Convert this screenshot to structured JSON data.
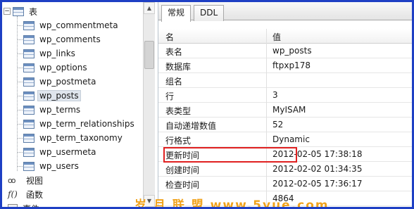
{
  "tree": {
    "root_label": "表",
    "tables": [
      "wp_commentmeta",
      "wp_comments",
      "wp_links",
      "wp_options",
      "wp_postmeta",
      "wp_posts",
      "wp_terms",
      "wp_term_relationships",
      "wp_term_taxonomy",
      "wp_usermeta",
      "wp_users"
    ],
    "selected_table": "wp_posts",
    "views_label": "视图",
    "functions_label": "函数",
    "events_label": "事件"
  },
  "tabs": {
    "general": "常规",
    "ddl": "DDL"
  },
  "properties": {
    "header": {
      "name": "名",
      "value": "值"
    },
    "rows": [
      {
        "name": "表名",
        "value": "wp_posts"
      },
      {
        "name": "数据库",
        "value": "ftpxp178"
      },
      {
        "name": "组名",
        "value": ""
      },
      {
        "name": "行",
        "value": "3"
      },
      {
        "name": "表类型",
        "value": "MyISAM"
      },
      {
        "name": "自动递增数值",
        "value": "52"
      },
      {
        "name": "行格式",
        "value": "Dynamic"
      },
      {
        "name": "更新时间",
        "value": "2012-02-05 17:38:18"
      },
      {
        "name": "创建时间",
        "value": "2012-02-02 01:34:35"
      },
      {
        "name": "检查时间",
        "value": "2012-02-05 17:36:17"
      },
      {
        "name": "",
        "value": "4864"
      }
    ]
  },
  "watermark": "岁 月 联 盟   www.5yue.com"
}
